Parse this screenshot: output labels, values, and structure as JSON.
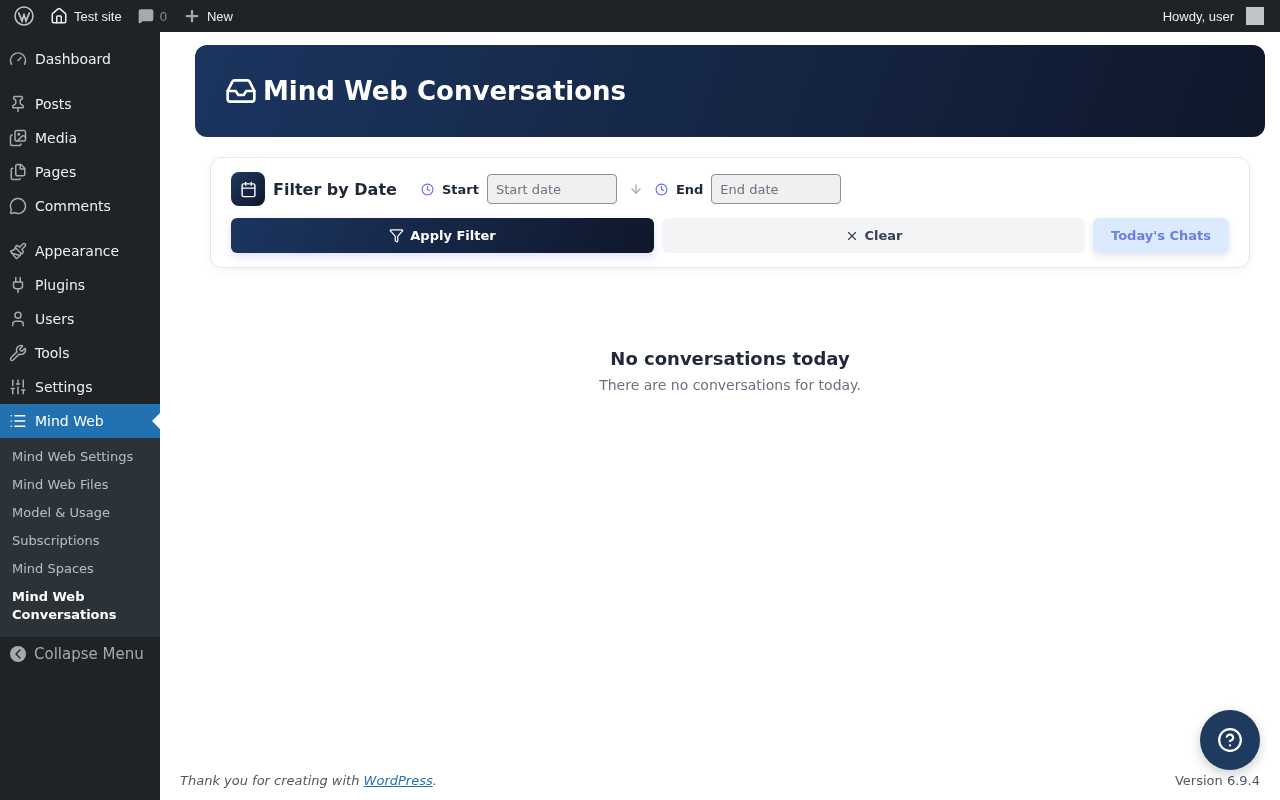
{
  "admin_bar": {
    "site_name": "Test site",
    "comments_count": "0",
    "new_label": "New",
    "greeting": "Howdy, user"
  },
  "sidebar": {
    "groups": [
      [
        {
          "label": "Dashboard",
          "selected": false
        }
      ],
      [
        {
          "label": "Posts",
          "selected": false
        },
        {
          "label": "Media",
          "selected": false
        },
        {
          "label": "Pages",
          "selected": false
        },
        {
          "label": "Comments",
          "selected": false
        }
      ],
      [
        {
          "label": "Appearance",
          "selected": false
        },
        {
          "label": "Plugins",
          "selected": false
        },
        {
          "label": "Users",
          "selected": false
        },
        {
          "label": "Tools",
          "selected": false
        },
        {
          "label": "Settings",
          "selected": false
        },
        {
          "label": "Mind Web",
          "selected": true
        }
      ]
    ],
    "submenu": [
      {
        "label": "Mind Web Settings",
        "selected": false
      },
      {
        "label": "Mind Web Files",
        "selected": false
      },
      {
        "label": "Model & Usage",
        "selected": false
      },
      {
        "label": "Subscriptions",
        "selected": false
      },
      {
        "label": "Mind Spaces",
        "selected": false
      },
      {
        "label": "Mind Web Conversations",
        "selected": true
      }
    ],
    "collapse_label": "Collapse Menu"
  },
  "header": {
    "title": "Mind Web Conversations"
  },
  "filter": {
    "title": "Filter by Date",
    "start_label": "Start",
    "start_placeholder": "Start date",
    "end_label": "End",
    "end_placeholder": "End date",
    "apply_button": "Apply Filter",
    "clear_button": "Clear",
    "today_button": "Today's Chats"
  },
  "empty_state": {
    "title": "No conversations today",
    "message": "There are no conversations for today."
  },
  "footer": {
    "text_before": "Thank you for creating with ",
    "link": "WordPress",
    "text_after": ".",
    "version": "Version 6.9.4"
  }
}
